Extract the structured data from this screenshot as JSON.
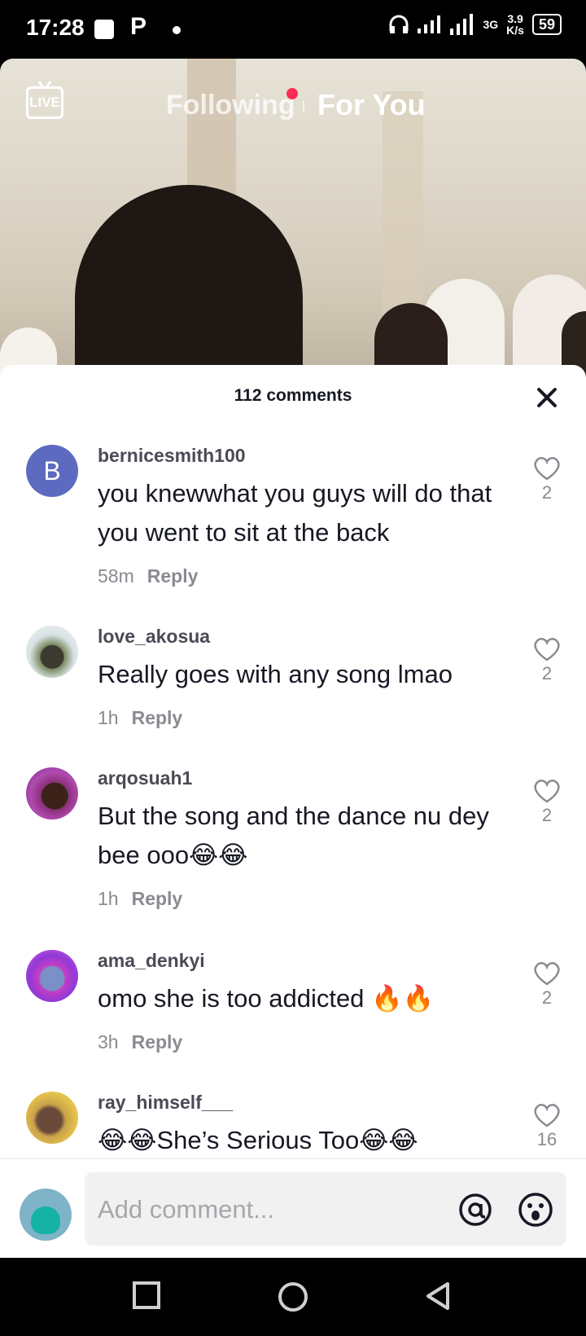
{
  "status_bar": {
    "time": "17:28",
    "p_icon": "P",
    "network_type": "3G",
    "speed_value": "3.9",
    "speed_unit": "K/s",
    "battery": "59"
  },
  "top_nav": {
    "live_label": "LIVE",
    "following_label": "Following",
    "for_you_label": "For You"
  },
  "comments_sheet": {
    "title": "112 comments",
    "comments": [
      {
        "username": "bernicesmith100",
        "avatar_letter": "B",
        "text": "you knewwhat you guys will do that you went to sit at the back",
        "time": "58m",
        "reply": "Reply",
        "likes": "2"
      },
      {
        "username": "love_akosua",
        "text": "Really goes with any song lmao",
        "time": "1h",
        "reply": "Reply",
        "likes": "2"
      },
      {
        "username": "arqosuah1",
        "text": "But the song and the dance nu dey bee ooo😂😂",
        "time": "1h",
        "reply": "Reply",
        "likes": "2"
      },
      {
        "username": "ama_denkyi",
        "text": "omo she is too addicted 🔥🔥",
        "time": "3h",
        "reply": "Reply",
        "likes": "2"
      },
      {
        "username": "ray_himself___",
        "text": "😂😂She’s Serious Too😂😂",
        "likes": "16"
      }
    ]
  },
  "comment_input": {
    "placeholder": "Add comment..."
  },
  "colors": {
    "accent": "#fe2c55",
    "avatar_b": "#5c6bc0"
  }
}
